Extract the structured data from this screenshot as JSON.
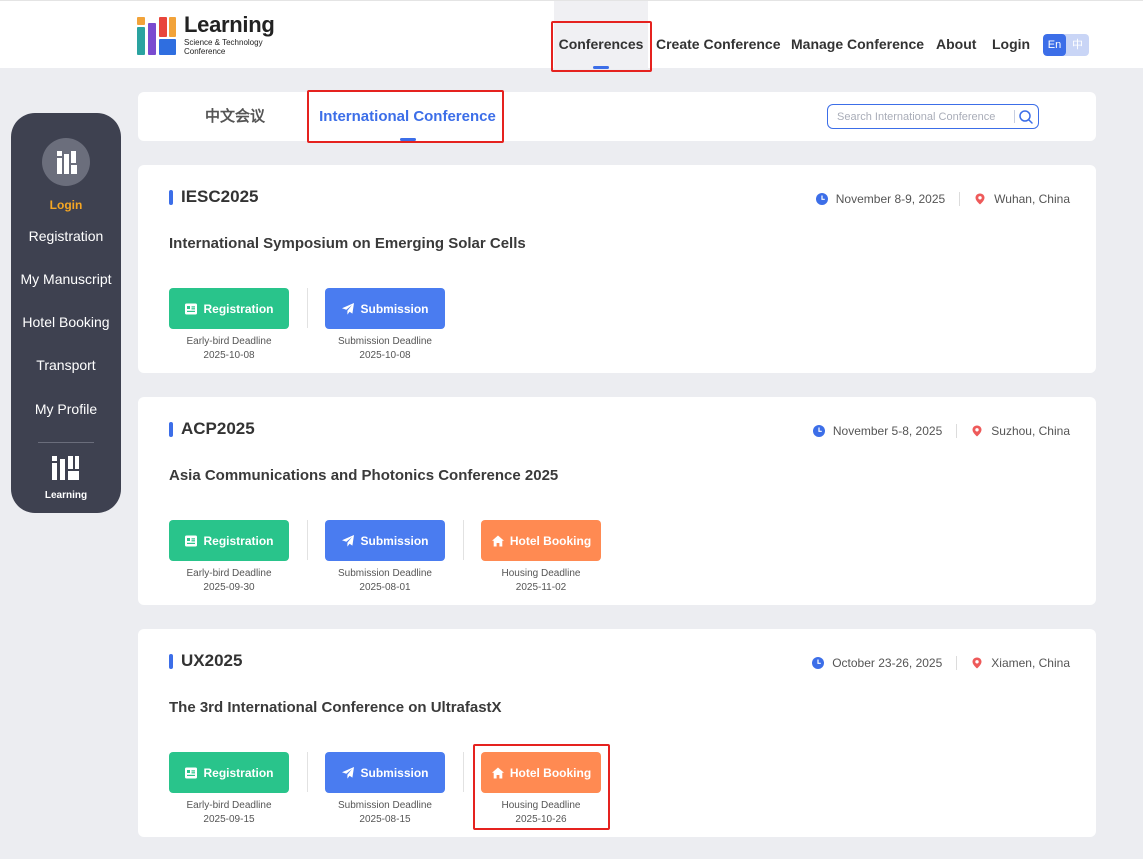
{
  "header": {
    "logo_title": "Learning",
    "logo_sub1": "Science & Technology",
    "logo_sub2": "Conference",
    "nav": {
      "conferences": "Conferences",
      "create": "Create Conference",
      "manage": "Manage Conference",
      "about": "About",
      "login": "Login"
    },
    "lang_en": "En",
    "lang_zh": "中"
  },
  "sidebar": {
    "login": "Login",
    "registration": "Registration",
    "my_manuscript": "My Manuscript",
    "hotel_booking": "Hotel Booking",
    "transport": "Transport",
    "my_profile": "My Profile",
    "logo_text": "Learning"
  },
  "tabs": {
    "chinese": "中文会议",
    "international": "International Conference"
  },
  "search": {
    "placeholder": "Search International Conference"
  },
  "colors": {
    "accent": "#3c6ee8",
    "registration": "#29c48b",
    "submission": "#4a7cf0",
    "hotel": "#ff8a52",
    "sidebar": "#3e4150",
    "login_highlight": "#f5a623"
  },
  "conferences": [
    {
      "code": "IESC2025",
      "date": "November 8-9, 2025",
      "location": "Wuhan, China",
      "title": "International Symposium on Emerging Solar Cells",
      "actions": {
        "registration": {
          "label": "Registration",
          "deadline_label": "Early-bird Deadline",
          "deadline": "2025-10-08"
        },
        "submission": {
          "label": "Submission",
          "deadline_label": "Submission Deadline",
          "deadline": "2025-10-08"
        }
      }
    },
    {
      "code": "ACP2025",
      "date": "November 5-8, 2025",
      "location": "Suzhou, China",
      "title": "Asia Communications and Photonics Conference 2025",
      "actions": {
        "registration": {
          "label": "Registration",
          "deadline_label": "Early-bird Deadline",
          "deadline": "2025-09-30"
        },
        "submission": {
          "label": "Submission",
          "deadline_label": "Submission Deadline",
          "deadline": "2025-08-01"
        },
        "hotel": {
          "label": "Hotel Booking",
          "deadline_label": "Housing Deadline",
          "deadline": "2025-11-02"
        }
      }
    },
    {
      "code": "UX2025",
      "date": "October 23-26, 2025",
      "location": "Xiamen, China",
      "title": "The 3rd International Conference on UltrafastX",
      "actions": {
        "registration": {
          "label": "Registration",
          "deadline_label": "Early-bird Deadline",
          "deadline": "2025-09-15"
        },
        "submission": {
          "label": "Submission",
          "deadline_label": "Submission Deadline",
          "deadline": "2025-08-15"
        },
        "hotel": {
          "label": "Hotel Booking",
          "deadline_label": "Housing Deadline",
          "deadline": "2025-10-26"
        }
      }
    }
  ]
}
